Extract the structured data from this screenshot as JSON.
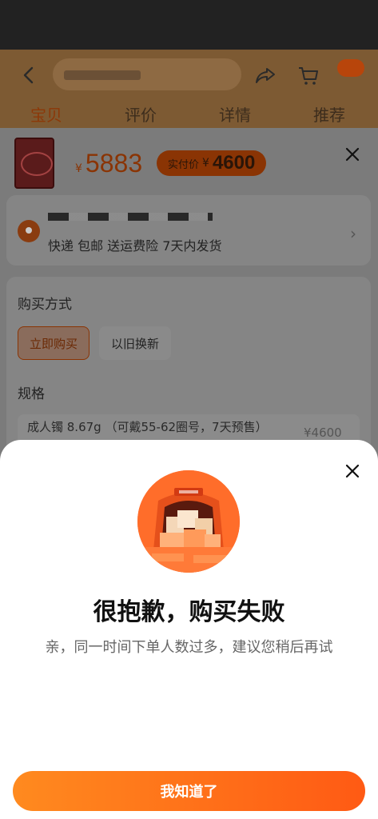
{
  "header": {
    "tabs": [
      {
        "label": "宝贝",
        "active": true
      },
      {
        "label": "评价",
        "active": false
      },
      {
        "label": "详情",
        "active": false
      },
      {
        "label": "推荐",
        "active": false
      }
    ]
  },
  "product": {
    "currency": "¥",
    "price": "5883",
    "actual_label": "实付价",
    "actual_currency": "¥",
    "actual_price": "4600"
  },
  "delivery": {
    "services": "快递 包邮  送运费险  7天内发货"
  },
  "purchase": {
    "title": "购买方式",
    "options": [
      "立即购买",
      "以旧换新"
    ],
    "spec_title": "规格",
    "spec_text": "成人镯 8.67g （可戴55-62圈号，7天预售）",
    "spec_price": "¥4600"
  },
  "modal": {
    "title": "很抱歉，购买失败",
    "message": "亲，同一时间下单人数过多，建议您稍后再试",
    "confirm_label": "我知道了"
  },
  "colors": {
    "accent": "#ff6a1a",
    "button_start": "#ff8a1f",
    "button_end": "#ff5a14"
  }
}
